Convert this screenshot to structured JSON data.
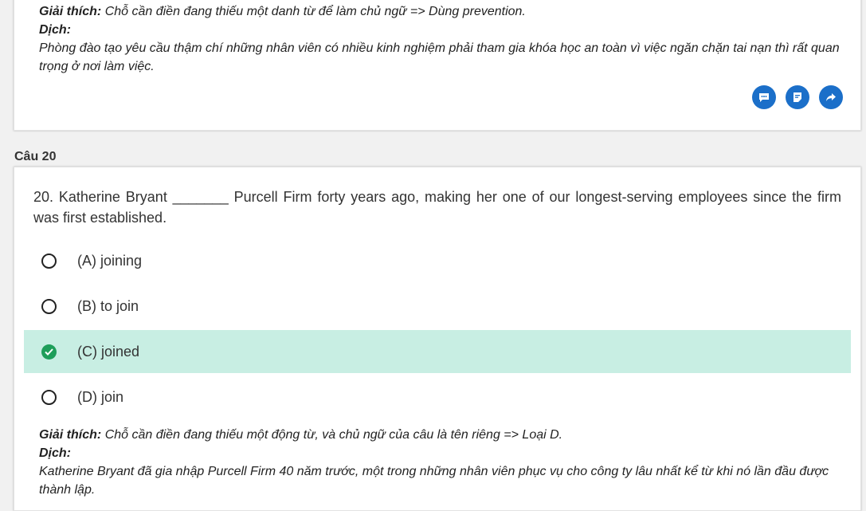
{
  "previous_question": {
    "explanation_label": "Giải thích:",
    "explanation_text": "Chỗ cần điền đang thiếu một danh từ để làm chủ ngữ => Dùng prevention.",
    "translation_label": "Dịch:",
    "translation_text": "Phòng đào tạo yêu cầu thậm chí những nhân viên có nhiều kinh nghiệm phải tham gia khóa học an toàn vì việc ngăn chặn tai nạn thì rất quan trọng ở nơi làm việc."
  },
  "actions": {
    "comment_icon": "comment-icon",
    "note_icon": "note-icon",
    "share_icon": "share-icon",
    "accent_color": "#1b6fc9"
  },
  "question": {
    "section_label": "Câu 20",
    "text": "20. Katherine Bryant _______ Purcell Firm forty years ago, making her one of our longest-serving employees since the firm was first established.",
    "options": [
      {
        "label": "(A) joining",
        "selected": false
      },
      {
        "label": "(B) to join",
        "selected": false
      },
      {
        "label": "(C) joined",
        "selected": true
      },
      {
        "label": "(D) join",
        "selected": false
      }
    ],
    "correct_color": "#c8eee3",
    "explanation_label": "Giải thích:",
    "explanation_text": "Chỗ cần điền đang thiếu một động từ, và chủ ngữ của câu là tên riêng => Loại D.",
    "translation_label": "Dịch:",
    "translation_text": "Katherine Bryant đã gia nhập Purcell Firm 40 năm trước, một trong những nhân viên phục vụ cho công ty lâu nhất kể từ khi nó lần đầu được thành lập."
  }
}
